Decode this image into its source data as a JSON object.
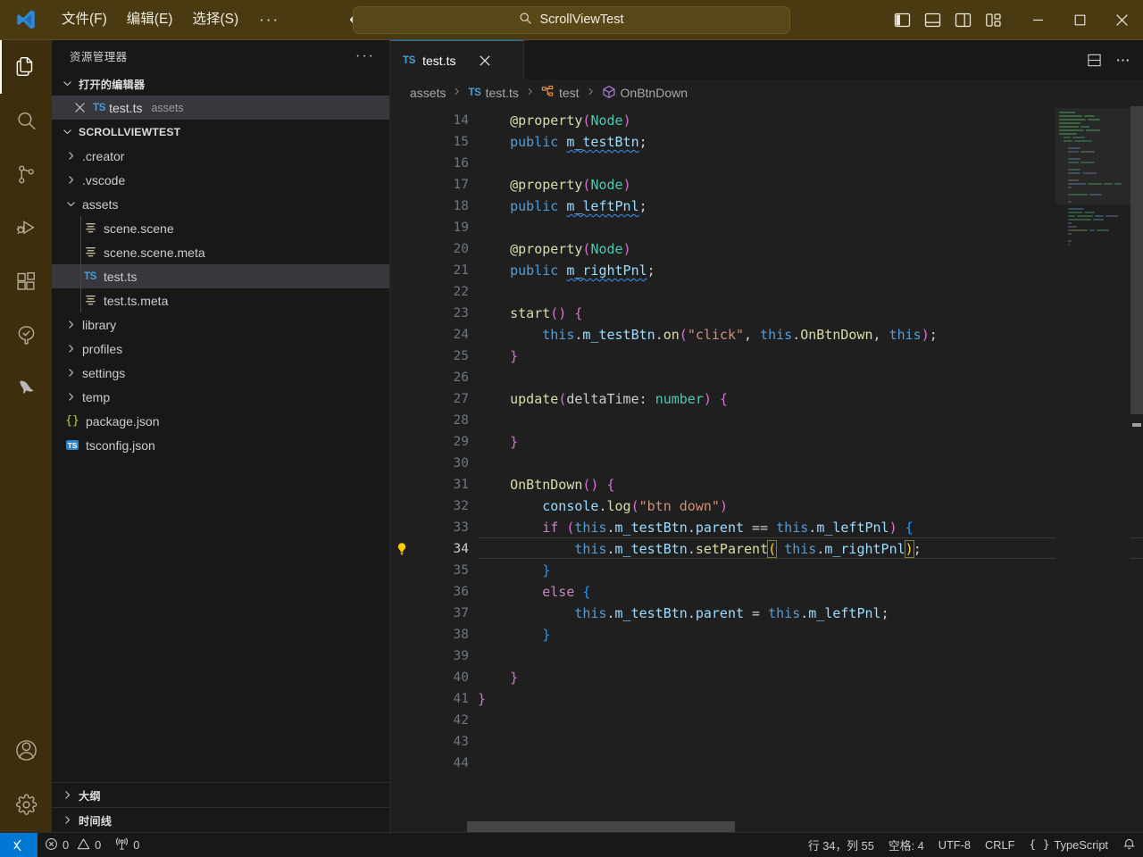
{
  "titlebar": {
    "logo_icon": "vscode-logo",
    "menus": [
      {
        "label": "文件(F)",
        "name": "menu-file"
      },
      {
        "label": "编辑(E)",
        "name": "menu-edit"
      },
      {
        "label": "选择(S)",
        "name": "menu-selection"
      }
    ],
    "more_menus_label": "···",
    "back_icon": "arrow-left-icon",
    "forward_icon": "arrow-right-icon",
    "command_center": {
      "icon": "search-icon",
      "text": "ScrollViewTest"
    },
    "layout_buttons": [
      {
        "name": "toggle-primary-sidebar-button",
        "icon": "layout-sidebar-left-icon"
      },
      {
        "name": "toggle-panel-button",
        "icon": "layout-panel-icon"
      },
      {
        "name": "toggle-secondary-sidebar-button",
        "icon": "layout-sidebar-right-icon"
      },
      {
        "name": "customize-layout-button",
        "icon": "layout-customize-icon"
      }
    ],
    "window_buttons": [
      {
        "name": "minimize-button",
        "icon": "minimize-icon"
      },
      {
        "name": "maximize-button",
        "icon": "maximize-icon"
      },
      {
        "name": "close-button",
        "icon": "close-icon"
      }
    ]
  },
  "activitybar": {
    "items": [
      {
        "name": "activity-explorer",
        "icon": "files-icon",
        "active": true
      },
      {
        "name": "activity-search",
        "icon": "search-icon",
        "active": false
      },
      {
        "name": "activity-source-control",
        "icon": "source-control-icon",
        "active": false
      },
      {
        "name": "activity-run-debug",
        "icon": "run-and-debug-icon",
        "active": false
      },
      {
        "name": "activity-extensions",
        "icon": "extensions-icon",
        "active": false
      },
      {
        "name": "activity-testing",
        "icon": "testing-beaker-icon",
        "active": false
      },
      {
        "name": "activity-cocos",
        "icon": "cocos-creator-icon",
        "active": false
      }
    ],
    "bottom_items": [
      {
        "name": "activity-accounts",
        "icon": "account-icon"
      },
      {
        "name": "activity-settings",
        "icon": "gear-icon"
      }
    ]
  },
  "sidebar": {
    "title": "资源管理器",
    "more_actions_label": "···",
    "open_editors": {
      "label": "打开的编辑器",
      "expanded": true,
      "items": [
        {
          "close_icon": "close-icon",
          "file_icon": "ts-icon",
          "name": "test.ts",
          "dir": "assets",
          "selected": true
        }
      ]
    },
    "workspace": {
      "label": "SCROLLVIEWTEST",
      "expanded": true,
      "items": [
        {
          "label": ".creator",
          "type": "folder",
          "depth": 0,
          "expanded": false,
          "icon": "chevron-right-icon",
          "selected": false
        },
        {
          "label": ".vscode",
          "type": "folder",
          "depth": 0,
          "expanded": false,
          "icon": "chevron-right-icon",
          "selected": false
        },
        {
          "label": "assets",
          "type": "folder",
          "depth": 0,
          "expanded": true,
          "icon": "chevron-down-icon",
          "selected": false
        },
        {
          "label": "scene.scene",
          "type": "file",
          "depth": 1,
          "icon": "file-lines-icon",
          "selected": false
        },
        {
          "label": "scene.scene.meta",
          "type": "file",
          "depth": 1,
          "icon": "file-lines-icon",
          "selected": false
        },
        {
          "label": "test.ts",
          "type": "file",
          "depth": 1,
          "icon": "ts-icon",
          "selected": true
        },
        {
          "label": "test.ts.meta",
          "type": "file",
          "depth": 1,
          "icon": "file-lines-icon",
          "selected": false
        },
        {
          "label": "library",
          "type": "folder",
          "depth": 0,
          "expanded": false,
          "icon": "chevron-right-icon",
          "selected": false
        },
        {
          "label": "profiles",
          "type": "folder",
          "depth": 0,
          "expanded": false,
          "icon": "chevron-right-icon",
          "selected": false
        },
        {
          "label": "settings",
          "type": "folder",
          "depth": 0,
          "expanded": false,
          "icon": "chevron-right-icon",
          "selected": false
        },
        {
          "label": "temp",
          "type": "folder",
          "depth": 0,
          "expanded": false,
          "icon": "chevron-right-icon",
          "selected": false
        },
        {
          "label": "package.json",
          "type": "file",
          "depth": 0,
          "icon": "json-braces-icon",
          "selected": false
        },
        {
          "label": "tsconfig.json",
          "type": "file",
          "depth": 0,
          "icon": "ts-square-icon",
          "selected": false
        }
      ]
    },
    "outline": {
      "label": "大纲",
      "expanded": false,
      "icon": "chevron-right-icon"
    },
    "timeline": {
      "label": "时间线",
      "expanded": false,
      "icon": "chevron-right-icon"
    }
  },
  "editor": {
    "tabs": [
      {
        "label": "test.ts",
        "icon": "ts-icon",
        "active": true,
        "close_icon": "close-icon"
      }
    ],
    "tab_actions": [
      {
        "name": "split-editor-button",
        "icon": "split-editor-horizontal-icon"
      },
      {
        "name": "editor-more-actions-button",
        "icon": "ellipsis-icon"
      }
    ],
    "breadcrumbs": [
      {
        "label": "assets",
        "icon": ""
      },
      {
        "label": "test.ts",
        "icon": "ts-icon"
      },
      {
        "label": "test",
        "icon": "symbol-class-icon"
      },
      {
        "label": "OnBtnDown",
        "icon": "symbol-method-icon"
      }
    ],
    "breadcrumb_separator": "›",
    "current_line": 34,
    "first_visible_line": 14,
    "lightbulb_icon": "lightbulb-icon",
    "lines": [
      {
        "n": 14,
        "tokens": [
          {
            "t": "    ",
            "c": "t-plain"
          },
          {
            "t": "@property",
            "c": "t-deco"
          },
          {
            "t": "(",
            "c": "t-p2"
          },
          {
            "t": "Node",
            "c": "t-type"
          },
          {
            "t": ")",
            "c": "t-p2"
          }
        ]
      },
      {
        "n": 15,
        "tokens": [
          {
            "t": "    ",
            "c": "t-plain"
          },
          {
            "t": "public",
            "c": "t-kw"
          },
          {
            "t": " ",
            "c": "t-plain"
          },
          {
            "t": "m_testBtn",
            "c": "t-var err-underline"
          },
          {
            "t": ";",
            "c": "t-plain"
          }
        ]
      },
      {
        "n": 16,
        "tokens": []
      },
      {
        "n": 17,
        "tokens": [
          {
            "t": "    ",
            "c": "t-plain"
          },
          {
            "t": "@property",
            "c": "t-deco"
          },
          {
            "t": "(",
            "c": "t-p2"
          },
          {
            "t": "Node",
            "c": "t-type"
          },
          {
            "t": ")",
            "c": "t-p2"
          }
        ]
      },
      {
        "n": 18,
        "tokens": [
          {
            "t": "    ",
            "c": "t-plain"
          },
          {
            "t": "public",
            "c": "t-kw"
          },
          {
            "t": " ",
            "c": "t-plain"
          },
          {
            "t": "m_leftPnl",
            "c": "t-var err-underline"
          },
          {
            "t": ";",
            "c": "t-plain"
          }
        ]
      },
      {
        "n": 19,
        "tokens": []
      },
      {
        "n": 20,
        "tokens": [
          {
            "t": "    ",
            "c": "t-plain"
          },
          {
            "t": "@property",
            "c": "t-deco"
          },
          {
            "t": "(",
            "c": "t-p2"
          },
          {
            "t": "Node",
            "c": "t-type"
          },
          {
            "t": ")",
            "c": "t-p2"
          }
        ]
      },
      {
        "n": 21,
        "tokens": [
          {
            "t": "    ",
            "c": "t-plain"
          },
          {
            "t": "public",
            "c": "t-kw"
          },
          {
            "t": " ",
            "c": "t-plain"
          },
          {
            "t": "m_rightPnl",
            "c": "t-var err-underline"
          },
          {
            "t": ";",
            "c": "t-plain"
          }
        ]
      },
      {
        "n": 22,
        "tokens": []
      },
      {
        "n": 23,
        "tokens": [
          {
            "t": "    ",
            "c": "t-plain"
          },
          {
            "t": "start",
            "c": "t-fn"
          },
          {
            "t": "()",
            "c": "t-p2"
          },
          {
            "t": " ",
            "c": "t-plain"
          },
          {
            "t": "{",
            "c": "t-p2"
          }
        ]
      },
      {
        "n": 24,
        "tokens": [
          {
            "t": "        ",
            "c": "t-plain"
          },
          {
            "t": "this",
            "c": "t-kw"
          },
          {
            "t": ".",
            "c": "t-plain"
          },
          {
            "t": "m_testBtn",
            "c": "t-var"
          },
          {
            "t": ".",
            "c": "t-plain"
          },
          {
            "t": "on",
            "c": "t-fn"
          },
          {
            "t": "(",
            "c": "t-p2"
          },
          {
            "t": "\"click\"",
            "c": "t-str"
          },
          {
            "t": ", ",
            "c": "t-plain"
          },
          {
            "t": "this",
            "c": "t-kw"
          },
          {
            "t": ".",
            "c": "t-plain"
          },
          {
            "t": "OnBtnDown",
            "c": "t-fn"
          },
          {
            "t": ", ",
            "c": "t-plain"
          },
          {
            "t": "this",
            "c": "t-kw"
          },
          {
            "t": ")",
            "c": "t-p2"
          },
          {
            "t": ";",
            "c": "t-plain"
          }
        ]
      },
      {
        "n": 25,
        "tokens": [
          {
            "t": "    ",
            "c": "t-plain"
          },
          {
            "t": "}",
            "c": "t-p2"
          }
        ]
      },
      {
        "n": 26,
        "tokens": []
      },
      {
        "n": 27,
        "tokens": [
          {
            "t": "    ",
            "c": "t-plain"
          },
          {
            "t": "update",
            "c": "t-fn"
          },
          {
            "t": "(",
            "c": "t-p2"
          },
          {
            "t": "deltaTime",
            "c": "t-plain"
          },
          {
            "t": ": ",
            "c": "t-plain"
          },
          {
            "t": "number",
            "c": "t-type"
          },
          {
            "t": ")",
            "c": "t-p2"
          },
          {
            "t": " ",
            "c": "t-plain"
          },
          {
            "t": "{",
            "c": "t-p2"
          }
        ]
      },
      {
        "n": 28,
        "tokens": []
      },
      {
        "n": 29,
        "tokens": [
          {
            "t": "    ",
            "c": "t-plain"
          },
          {
            "t": "}",
            "c": "t-p2"
          }
        ]
      },
      {
        "n": 30,
        "tokens": []
      },
      {
        "n": 31,
        "tokens": [
          {
            "t": "    ",
            "c": "t-plain"
          },
          {
            "t": "OnBtnDown",
            "c": "t-fn"
          },
          {
            "t": "()",
            "c": "t-p2"
          },
          {
            "t": " ",
            "c": "t-plain"
          },
          {
            "t": "{",
            "c": "t-p2"
          }
        ]
      },
      {
        "n": 32,
        "tokens": [
          {
            "t": "        ",
            "c": "t-plain"
          },
          {
            "t": "console",
            "c": "t-var"
          },
          {
            "t": ".",
            "c": "t-plain"
          },
          {
            "t": "log",
            "c": "t-fn"
          },
          {
            "t": "(",
            "c": "t-p2"
          },
          {
            "t": "\"btn down\"",
            "c": "t-str"
          },
          {
            "t": ")",
            "c": "t-p2"
          }
        ]
      },
      {
        "n": 33,
        "tokens": [
          {
            "t": "        ",
            "c": "t-plain"
          },
          {
            "t": "if",
            "c": "t-ctrl"
          },
          {
            "t": " ",
            "c": "t-plain"
          },
          {
            "t": "(",
            "c": "t-p2"
          },
          {
            "t": "this",
            "c": "t-kw"
          },
          {
            "t": ".",
            "c": "t-plain"
          },
          {
            "t": "m_testBtn",
            "c": "t-var"
          },
          {
            "t": ".",
            "c": "t-plain"
          },
          {
            "t": "parent",
            "c": "t-var"
          },
          {
            "t": " == ",
            "c": "t-plain"
          },
          {
            "t": "this",
            "c": "t-kw"
          },
          {
            "t": ".",
            "c": "t-plain"
          },
          {
            "t": "m_leftPnl",
            "c": "t-var"
          },
          {
            "t": ")",
            "c": "t-p2"
          },
          {
            "t": " ",
            "c": "t-plain"
          },
          {
            "t": "{",
            "c": "t-p3"
          }
        ]
      },
      {
        "n": 34,
        "tokens": [
          {
            "t": "            ",
            "c": "t-plain"
          },
          {
            "t": "this",
            "c": "t-kw"
          },
          {
            "t": ".",
            "c": "t-plain"
          },
          {
            "t": "m_testBtn",
            "c": "t-var"
          },
          {
            "t": ".",
            "c": "t-plain"
          },
          {
            "t": "setParent",
            "c": "t-fn"
          },
          {
            "t": "(",
            "c": "t-p1 bracket-hl"
          },
          {
            "t": " ",
            "c": "t-plain"
          },
          {
            "t": "this",
            "c": "t-kw"
          },
          {
            "t": ".",
            "c": "t-plain"
          },
          {
            "t": "m_rightPnl",
            "c": "t-var"
          },
          {
            "t": ")",
            "c": "t-p1 bracket-hl"
          },
          {
            "t": ";",
            "c": "t-plain"
          }
        ]
      },
      {
        "n": 35,
        "tokens": [
          {
            "t": "        ",
            "c": "t-plain"
          },
          {
            "t": "}",
            "c": "t-p3"
          }
        ]
      },
      {
        "n": 36,
        "tokens": [
          {
            "t": "        ",
            "c": "t-plain"
          },
          {
            "t": "else",
            "c": "t-ctrl"
          },
          {
            "t": " ",
            "c": "t-plain"
          },
          {
            "t": "{",
            "c": "t-p3"
          }
        ]
      },
      {
        "n": 37,
        "tokens": [
          {
            "t": "            ",
            "c": "t-plain"
          },
          {
            "t": "this",
            "c": "t-kw"
          },
          {
            "t": ".",
            "c": "t-plain"
          },
          {
            "t": "m_testBtn",
            "c": "t-var"
          },
          {
            "t": ".",
            "c": "t-plain"
          },
          {
            "t": "parent",
            "c": "t-var"
          },
          {
            "t": " = ",
            "c": "t-plain"
          },
          {
            "t": "this",
            "c": "t-kw"
          },
          {
            "t": ".",
            "c": "t-plain"
          },
          {
            "t": "m_leftPnl",
            "c": "t-var"
          },
          {
            "t": ";",
            "c": "t-plain"
          }
        ]
      },
      {
        "n": 38,
        "tokens": [
          {
            "t": "        ",
            "c": "t-plain"
          },
          {
            "t": "}",
            "c": "t-p3"
          }
        ]
      },
      {
        "n": 39,
        "tokens": []
      },
      {
        "n": 40,
        "tokens": [
          {
            "t": "    ",
            "c": "t-plain"
          },
          {
            "t": "}",
            "c": "t-p2"
          }
        ]
      },
      {
        "n": 41,
        "tokens": [
          {
            "t": "}",
            "c": "t-p2"
          }
        ]
      },
      {
        "n": 42,
        "tokens": []
      },
      {
        "n": 43,
        "tokens": []
      },
      {
        "n": 44,
        "tokens": []
      }
    ]
  },
  "statusbar": {
    "remote_icon": "remote-window-icon",
    "left": [
      {
        "name": "status-problems",
        "icon": "error-icon",
        "label": "0",
        "icon2": "warning-icon",
        "label2": "0"
      },
      {
        "name": "status-ports",
        "icon": "radio-tower-icon",
        "label": "0"
      }
    ],
    "problems_errors": "0",
    "problems_warnings": "0",
    "ports": "0",
    "right": [
      {
        "name": "status-cursor-position",
        "label": "行 34，列 55"
      },
      {
        "name": "status-indentation",
        "label": "空格: 4"
      },
      {
        "name": "status-encoding",
        "label": "UTF-8"
      },
      {
        "name": "status-eol",
        "label": "CRLF"
      },
      {
        "name": "status-language-mode",
        "label": "TypeScript",
        "icon": "json-braces-icon"
      },
      {
        "name": "status-notifications",
        "label": "",
        "icon": "bell-icon"
      }
    ]
  },
  "colors": {
    "titlebar_bg": "#4a3a12",
    "activitybar_bg": "#3d2f0e",
    "sidebar_bg": "#181818",
    "editor_bg": "#1f1f1f",
    "accent": "#0078d4",
    "selection_bg": "#37373d"
  }
}
